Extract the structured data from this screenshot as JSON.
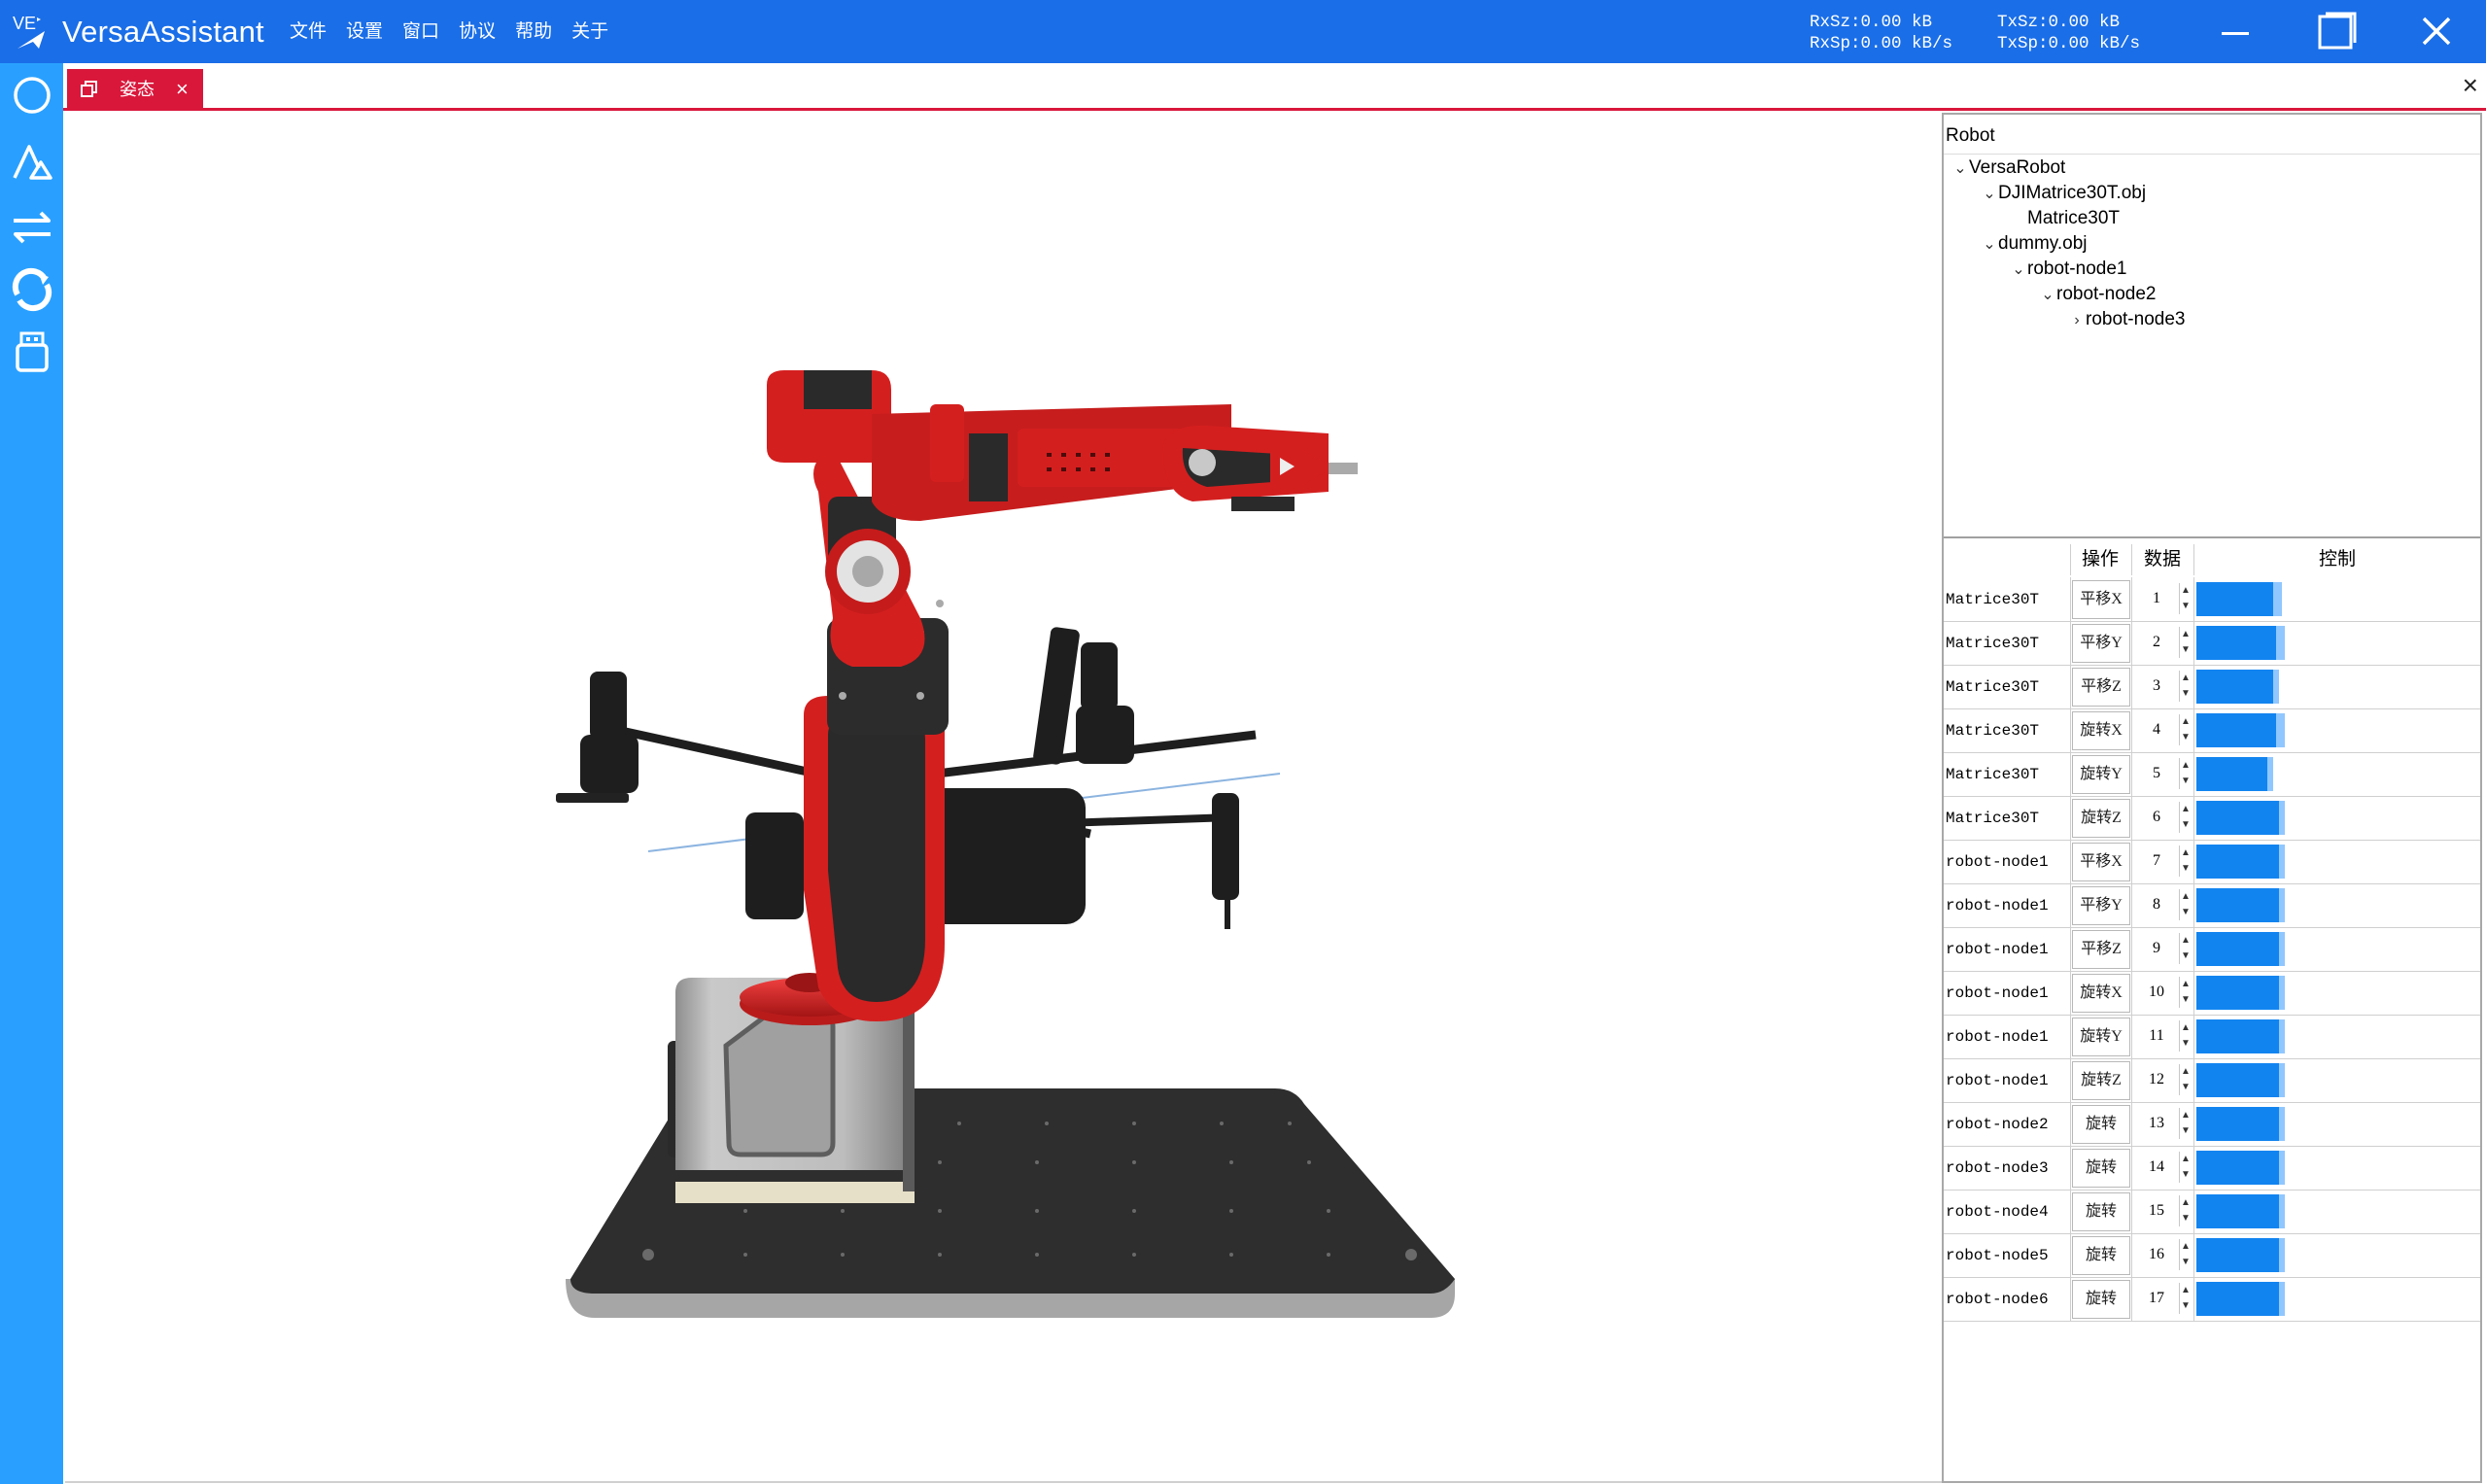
{
  "app": {
    "title": "VersaAssistant",
    "logo_text": "VE",
    "menu": [
      "文件",
      "设置",
      "窗口",
      "协议",
      "帮助",
      "关于"
    ],
    "net": {
      "rx_size": "RxSz:0.00 kB",
      "rx_speed": "RxSp:0.00 kB/s",
      "tx_size": "TxSz:0.00 kB",
      "tx_speed": "TxSp:0.00 kB/s"
    }
  },
  "colors": {
    "titlebar": "#1a6ee8",
    "toolbar": "#29a0ff",
    "tab_accent": "#d9173b",
    "bar_fill": "#1284f0",
    "bar_track": "#91c7ff",
    "robot_red": "#d41f1f"
  },
  "toolbar_icons": [
    "circle-icon",
    "triangle-shapes-icon",
    "swap-arrows-icon",
    "refresh-arrows-icon",
    "usb-device-icon"
  ],
  "tabs": [
    {
      "label": "姿态",
      "close": "×",
      "active": true
    }
  ],
  "tabbar_close": "×",
  "tree": {
    "header": "Robot",
    "nodes": [
      {
        "label": "VersaRobot",
        "depth": 0,
        "expander": "expanded"
      },
      {
        "label": "DJIMatrice30T.obj",
        "depth": 1,
        "expander": "expanded"
      },
      {
        "label": "Matrice30T",
        "depth": 2,
        "expander": "none"
      },
      {
        "label": "dummy.obj",
        "depth": 1,
        "expander": "expanded"
      },
      {
        "label": "robot-node1",
        "depth": 2,
        "expander": "expanded"
      },
      {
        "label": "robot-node2",
        "depth": 3,
        "expander": "expanded"
      },
      {
        "label": "robot-node3",
        "depth": 4,
        "expander": "collapsed"
      }
    ]
  },
  "control_table": {
    "columns": [
      "",
      "操作",
      "数据",
      "控制"
    ],
    "rows": [
      {
        "name": "Matrice30T",
        "op": "平移X",
        "value": "1",
        "fill": 0.27,
        "track": 0.3
      },
      {
        "name": "Matrice30T",
        "op": "平移Y",
        "value": "2",
        "fill": 0.28,
        "track": 0.31
      },
      {
        "name": "Matrice30T",
        "op": "平移Z",
        "value": "3",
        "fill": 0.27,
        "track": 0.29
      },
      {
        "name": "Matrice30T",
        "op": "旋转X",
        "value": "4",
        "fill": 0.28,
        "track": 0.31
      },
      {
        "name": "Matrice30T",
        "op": "旋转Y",
        "value": "5",
        "fill": 0.25,
        "track": 0.27
      },
      {
        "name": "Matrice30T",
        "op": "旋转Z",
        "value": "6",
        "fill": 0.29,
        "track": 0.31
      },
      {
        "name": "robot-node1",
        "op": "平移X",
        "value": "7",
        "fill": 0.29,
        "track": 0.31
      },
      {
        "name": "robot-node1",
        "op": "平移Y",
        "value": "8",
        "fill": 0.29,
        "track": 0.31
      },
      {
        "name": "robot-node1",
        "op": "平移Z",
        "value": "9",
        "fill": 0.29,
        "track": 0.31
      },
      {
        "name": "robot-node1",
        "op": "旋转X",
        "value": "10",
        "fill": 0.29,
        "track": 0.31
      },
      {
        "name": "robot-node1",
        "op": "旋转Y",
        "value": "11",
        "fill": 0.29,
        "track": 0.31
      },
      {
        "name": "robot-node1",
        "op": "旋转Z",
        "value": "12",
        "fill": 0.29,
        "track": 0.31
      },
      {
        "name": "robot-node2",
        "op": "旋转",
        "value": "13",
        "fill": 0.29,
        "track": 0.31
      },
      {
        "name": "robot-node3",
        "op": "旋转",
        "value": "14",
        "fill": 0.29,
        "track": 0.31
      },
      {
        "name": "robot-node4",
        "op": "旋转",
        "value": "15",
        "fill": 0.29,
        "track": 0.31
      },
      {
        "name": "robot-node5",
        "op": "旋转",
        "value": "16",
        "fill": 0.29,
        "track": 0.31
      },
      {
        "name": "robot-node6",
        "op": "旋转",
        "value": "17",
        "fill": 0.29,
        "track": 0.31
      }
    ]
  }
}
